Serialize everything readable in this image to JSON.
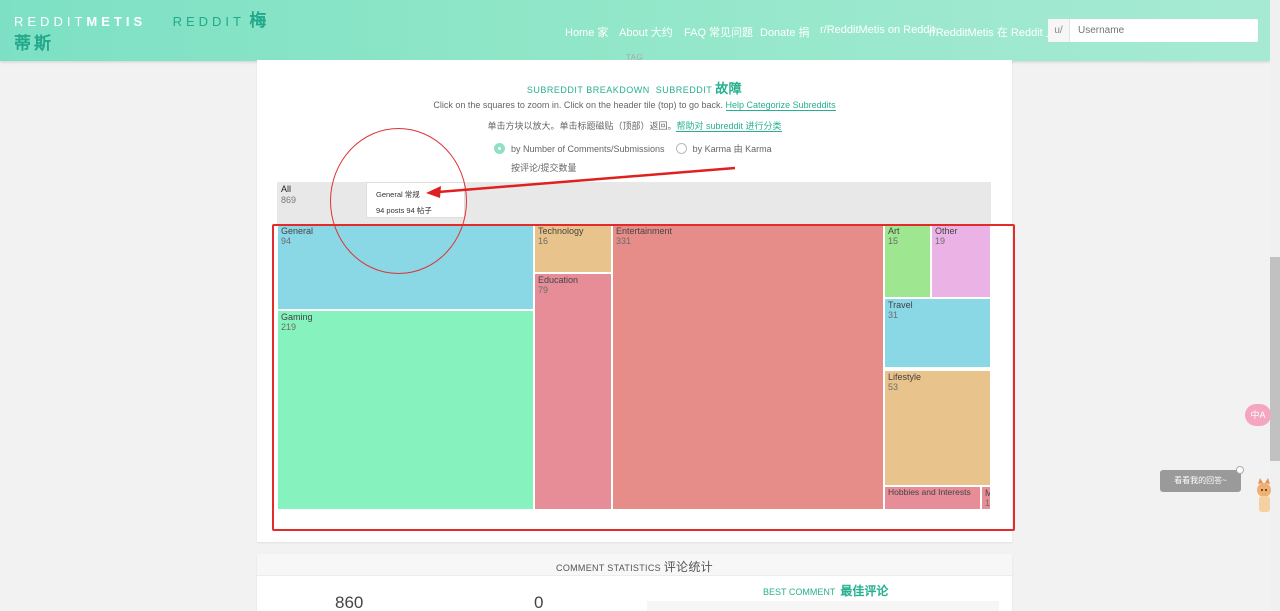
{
  "header": {
    "brand_left": "REDDIT",
    "brand_bold": "METIS",
    "brand_reddit": "REDDIT",
    "brand_zh": "梅蒂斯",
    "nav": [
      {
        "label": "Home 家"
      },
      {
        "label": "About 大约"
      },
      {
        "label": "FAQ 常见问题"
      },
      {
        "label": "Donate 捐"
      },
      {
        "label": "r/RedditMetis on Reddit"
      },
      {
        "label": "r/RedditMetis 在 Reddit 上"
      }
    ],
    "search_prefix": "u/",
    "search_placeholder": "Username"
  },
  "breakdown": {
    "cut_title": "TAG",
    "title_en": "SUBREDDIT BREAKDOWN",
    "title_en2": "SUBREDDIT",
    "title_zh": "故障",
    "hint_en": "Click on the squares to zoom in. Click on the header tile (top) to go back.",
    "hint_en_link": "Help Categorize Subreddits",
    "hint_zh": "单击方块以放大。单击标题磁贴（顶部）返回。",
    "hint_zh_link": "帮助对 subreddit 进行分类",
    "radio_comments": "by Number of Comments/Submissions",
    "radio_karma": "by Karma  由 Karma",
    "radio_sub_zh": "按评论/提交数量"
  },
  "treemap": {
    "root_label": "All",
    "root_value": "869",
    "tooltip_title": "General  常规",
    "tooltip_posts": "94 posts  94 帖子",
    "tiles": [
      {
        "label": "General",
        "value": "94",
        "color": "#8ad7e6"
      },
      {
        "label": "Gaming",
        "value": "219",
        "color": "#86f2bd"
      },
      {
        "label": "Technology",
        "value": "16",
        "color": "#e9c38c"
      },
      {
        "label": "Education",
        "value": "79",
        "color": "#e68d98"
      },
      {
        "label": "Entertainment",
        "value": "331",
        "color": "#e68d8a"
      },
      {
        "label": "Art",
        "value": "15",
        "color": "#9ee68f"
      },
      {
        "label": "Other",
        "value": "19",
        "color": "#ebb2e6"
      },
      {
        "label": "Travel",
        "value": "31",
        "color": "#8ad7e6"
      },
      {
        "label": "Lifestyle",
        "value": "53",
        "color": "#e9c38c"
      },
      {
        "label": "Hobbies and Interests",
        "value": "",
        "color": "#e68d98"
      },
      {
        "label": "M",
        "value": "1",
        "color": "#e68d98"
      }
    ]
  },
  "widgets": {
    "bubble_text": "看看我的回答~",
    "pink_text": "中A"
  },
  "comment_stats": {
    "title_en": "COMMENT STATISTICS",
    "title_zh": "评论统计",
    "stat1": "860",
    "stat2": "0",
    "best_en": "BEST COMMENT",
    "best_zh": "最佳评论"
  }
}
